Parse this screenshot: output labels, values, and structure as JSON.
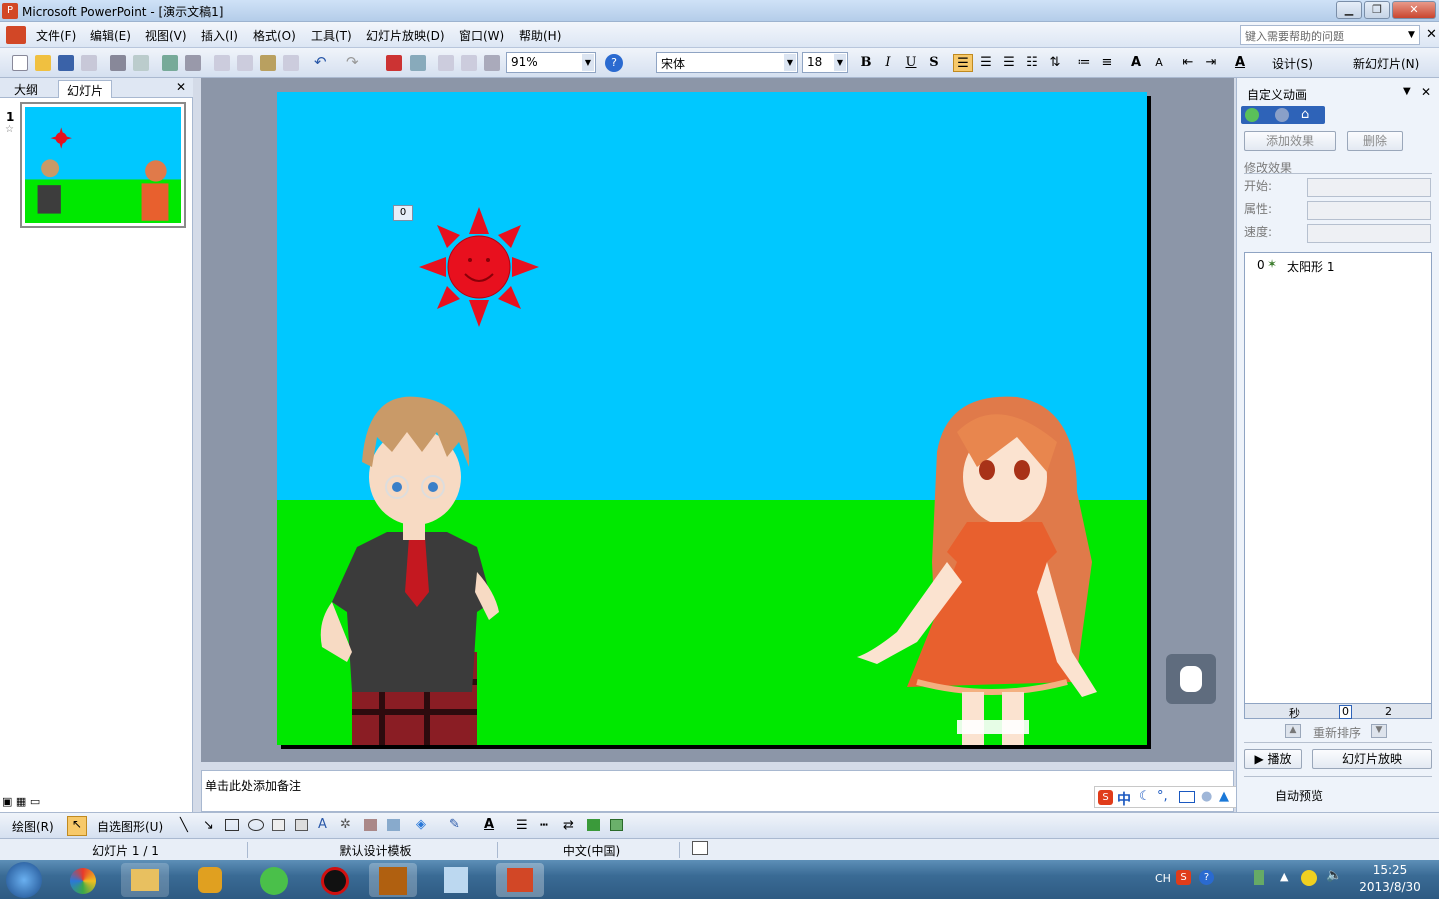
{
  "window": {
    "title": "Microsoft PowerPoint - [演示文稿1]"
  },
  "menu": {
    "items": [
      "文件(F)",
      "编辑(E)",
      "视图(V)",
      "插入(I)",
      "格式(O)",
      "工具(T)",
      "幻灯片放映(D)",
      "窗口(W)",
      "帮助(H)"
    ],
    "help_placeholder": "键入需要帮助的问题"
  },
  "toolbar": {
    "zoom": "91%",
    "font": "宋体",
    "font_size": "18",
    "bold": "B",
    "italic": "I",
    "underline": "U",
    "shadow": "S",
    "design_label": "设计(S)",
    "new_slide_label": "新幻灯片(N)"
  },
  "left_pane": {
    "tabs": [
      "大纲",
      "幻灯片"
    ],
    "slide_number": "1"
  },
  "slide": {
    "anim_marker": "0",
    "colors": {
      "sky": "#00c8ff",
      "grass": "#00e800",
      "sun": "#e8101e"
    }
  },
  "notes": {
    "placeholder": "单击此处添加备注"
  },
  "task_pane": {
    "title": "自定义动画",
    "add_effect": "添加效果",
    "remove": "删除",
    "modify_heading": "修改效果",
    "start_label": "开始:",
    "property_label": "属性:",
    "speed_label": "速度:",
    "anim_items": [
      {
        "order": "0",
        "name": "太阳形 1"
      }
    ],
    "timeline_unit": "秒",
    "timeline_ticks": [
      "0",
      "2"
    ],
    "reorder_label": "重新排序",
    "play_label": "播放",
    "slideshow_label": "幻灯片放映",
    "autopreview_label": "自动预览"
  },
  "drawing_toolbar": {
    "draw_label": "绘图(R)",
    "autoshapes_label": "自选图形(U)"
  },
  "status_bar": {
    "slide_info": "幻灯片 1 / 1",
    "template": "默认设计模板",
    "language": "中文(中国)"
  },
  "taskbar": {
    "lang": "CH",
    "time": "15:25",
    "date": "2013/8/30"
  },
  "ime": {
    "mode": "中"
  }
}
